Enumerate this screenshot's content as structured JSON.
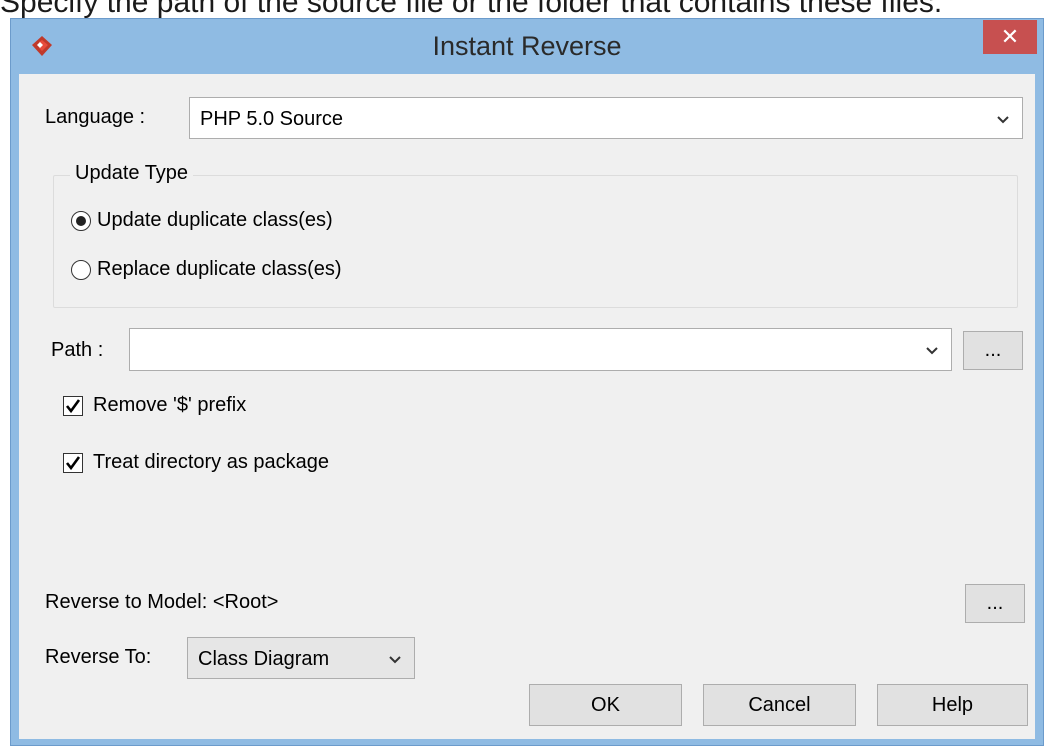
{
  "caption": "Specify the path of the source file or the folder that contains these files.",
  "window": {
    "title": "Instant Reverse",
    "close_glyph": "✕"
  },
  "language": {
    "label": "Language :",
    "value": "PHP 5.0 Source"
  },
  "update_type": {
    "legend": "Update Type",
    "options": [
      {
        "label": "Update duplicate class(es)",
        "selected": true
      },
      {
        "label": "Replace duplicate class(es)",
        "selected": false
      }
    ]
  },
  "path": {
    "label": "Path :",
    "value": "",
    "browse_label": "..."
  },
  "options": {
    "remove_prefix": {
      "label": "Remove '$' prefix",
      "checked": true
    },
    "treat_directory": {
      "label": "Treat directory as package",
      "checked": true
    }
  },
  "reverse_model": {
    "label": "Reverse to Model: <Root>",
    "browse_label": "..."
  },
  "reverse_to": {
    "label": "Reverse To:",
    "value": "Class Diagram"
  },
  "buttons": {
    "ok": "OK",
    "cancel": "Cancel",
    "help": "Help"
  },
  "colors": {
    "title_bar": "#8fbbe3",
    "close_button": "#c75050",
    "dialog_bg": "#f0f0f0",
    "app_icon": "#c0392b"
  },
  "icons": [
    "app-logo-icon",
    "close-icon",
    "chevron-down-icon",
    "radio-selected-icon",
    "checkmark-icon"
  ]
}
